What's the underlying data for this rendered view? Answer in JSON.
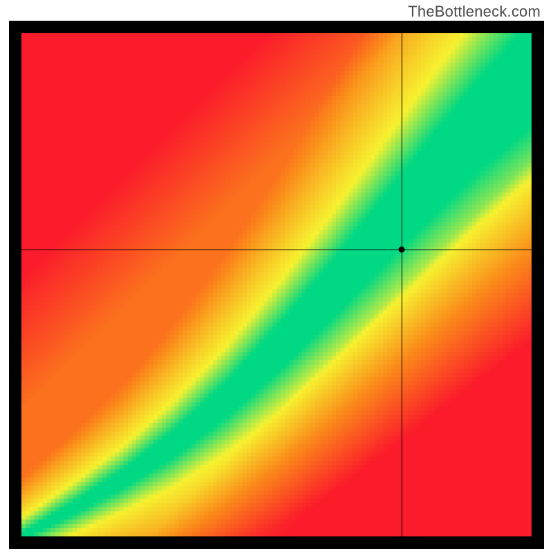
{
  "watermark": "TheBottleneck.com",
  "chart_data": {
    "type": "heatmap",
    "title": "",
    "xlabel": "",
    "ylabel": "",
    "xlim": [
      0,
      1
    ],
    "ylim": [
      0,
      1
    ],
    "grid": false,
    "legend": false,
    "crosshair": {
      "x": 0.745,
      "y": 0.57
    },
    "marker": {
      "x": 0.745,
      "y": 0.57
    },
    "ridge": {
      "description": "Green optimal band along a curved diagonal from bottom-left to top-right; band widens with x. Colors transition red→orange→yellow→green toward the ridge.",
      "control_points_x": [
        0.0,
        0.1,
        0.2,
        0.3,
        0.4,
        0.5,
        0.6,
        0.7,
        0.8,
        0.9,
        1.0
      ],
      "control_points_y": [
        0.0,
        0.055,
        0.115,
        0.185,
        0.27,
        0.37,
        0.48,
        0.595,
        0.71,
        0.82,
        0.92
      ],
      "half_width": [
        0.006,
        0.012,
        0.018,
        0.026,
        0.034,
        0.044,
        0.054,
        0.066,
        0.078,
        0.09,
        0.102
      ],
      "yellow_falloff": [
        0.02,
        0.03,
        0.04,
        0.055,
        0.07,
        0.085,
        0.1,
        0.115,
        0.13,
        0.145,
        0.16
      ]
    },
    "color_stops": {
      "red": "#fb1b2b",
      "orange": "#fb8a1a",
      "yellow": "#f7f230",
      "green": "#00d884"
    },
    "resolution": 120
  }
}
